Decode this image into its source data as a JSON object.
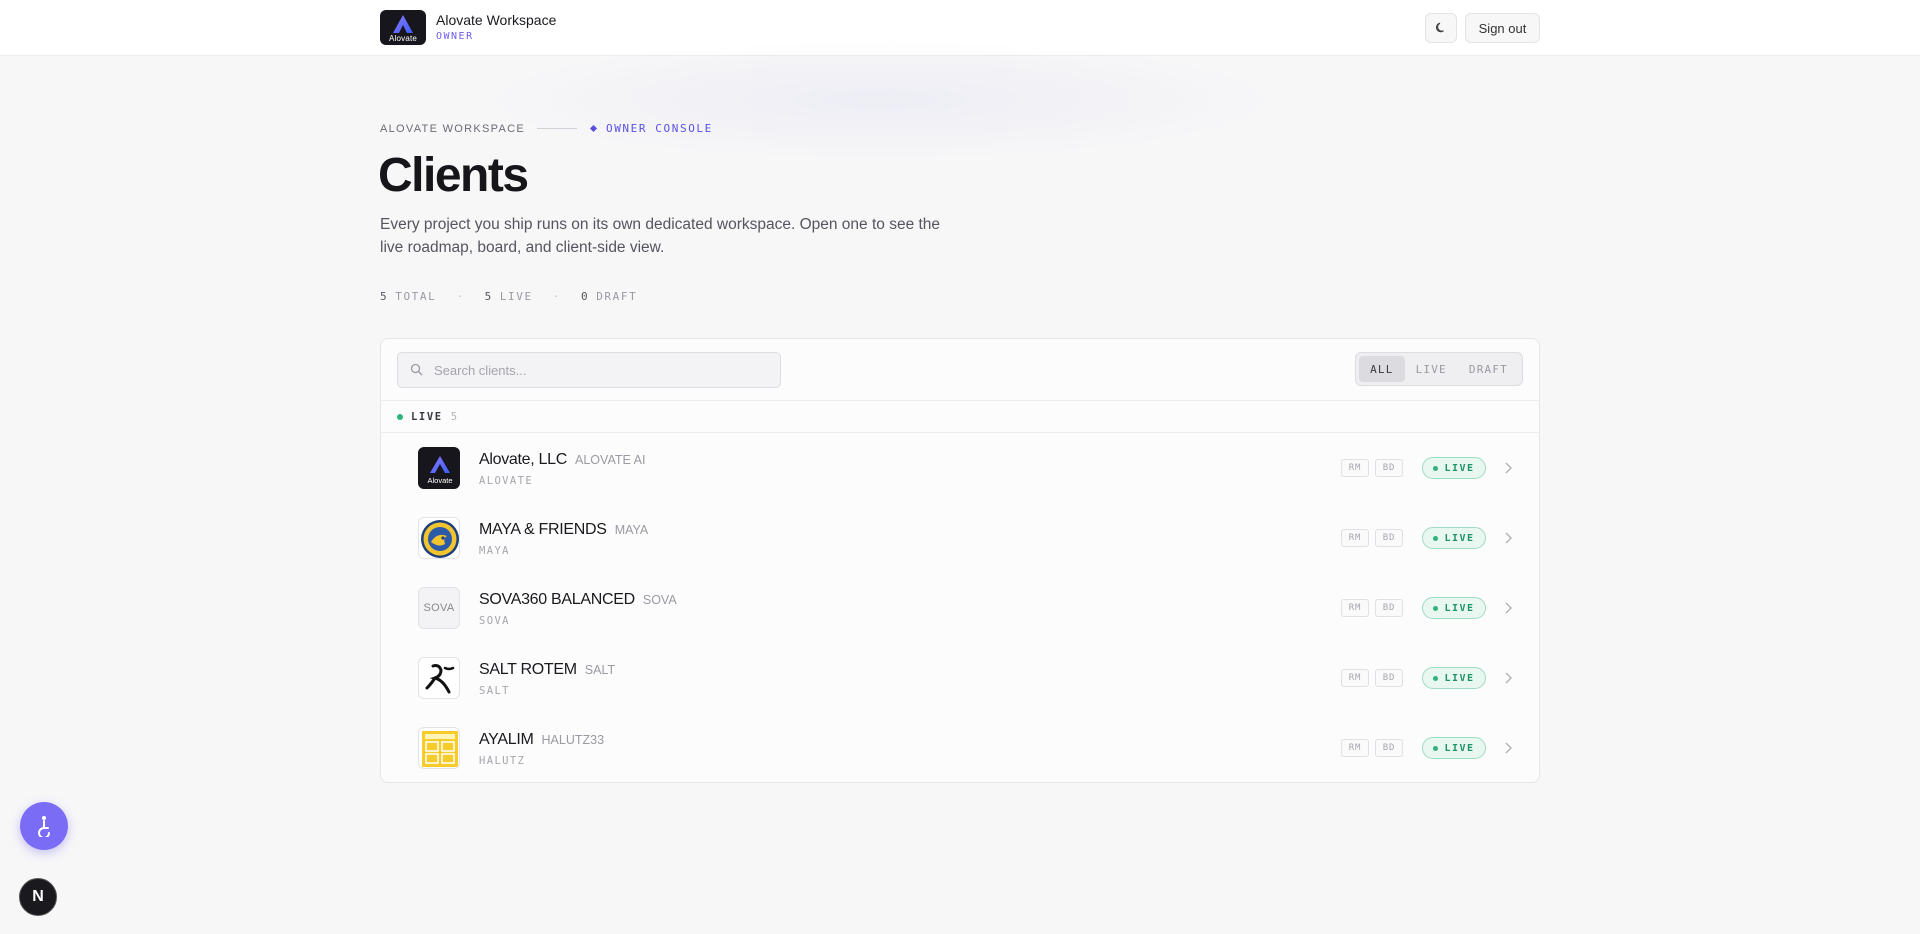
{
  "topbar": {
    "logo_text": "Alovate",
    "title": "Alovate Workspace",
    "role": "OWNER",
    "theme_icon": "moon-icon",
    "signout_label": "Sign out"
  },
  "header": {
    "breadcrumb_workspace": "ALOVATE WORKSPACE",
    "breadcrumb_console": "OWNER CONSOLE",
    "title": "Clients",
    "description": "Every project you ship runs on its own dedicated workspace. Open one to see the live roadmap, board, and client-side view."
  },
  "stats": {
    "total_count": "5",
    "total_label": "TOTAL",
    "live_count": "5",
    "live_label": "LIVE",
    "draft_count": "0",
    "draft_label": "DRAFT"
  },
  "toolbar": {
    "search_placeholder": "Search clients...",
    "filters": [
      "ALL",
      "LIVE",
      "DRAFT"
    ],
    "active_filter": "ALL"
  },
  "group": {
    "label": "LIVE",
    "count": "5"
  },
  "clients": [
    {
      "name": "Alovate, LLC",
      "alias": "ALOVATE AI",
      "slug": "ALOVATE",
      "logo": "alovate-logo",
      "logo_text": "Alovate",
      "tag1": "RM",
      "tag2": "BD",
      "status": "LIVE"
    },
    {
      "name": "MAYA & FRIENDS",
      "alias": "MAYA",
      "slug": "MAYA",
      "logo": "maya-logo",
      "tag1": "RM",
      "tag2": "BD",
      "status": "LIVE"
    },
    {
      "name": "SOVA360 BALANCED",
      "alias": "SOVA",
      "slug": "SOVA",
      "logo": "sova-logo",
      "logo_text": "SOVA",
      "tag1": "RM",
      "tag2": "BD",
      "status": "LIVE"
    },
    {
      "name": "SALT ROTEM",
      "alias": "SALT",
      "slug": "SALT",
      "logo": "salt-logo",
      "tag1": "RM",
      "tag2": "BD",
      "status": "LIVE"
    },
    {
      "name": "AYALIM",
      "alias": "HALUTZ33",
      "slug": "HALUTZ",
      "logo": "ayalim-logo",
      "tag1": "RM",
      "tag2": "BD",
      "status": "LIVE"
    }
  ],
  "colors": {
    "accent": "#5b4fe0",
    "live_green": "#2fb37f",
    "fab": "#7b6cf6"
  },
  "floating": {
    "accessibility_icon": "accessibility-icon",
    "badge_letter": "N"
  }
}
